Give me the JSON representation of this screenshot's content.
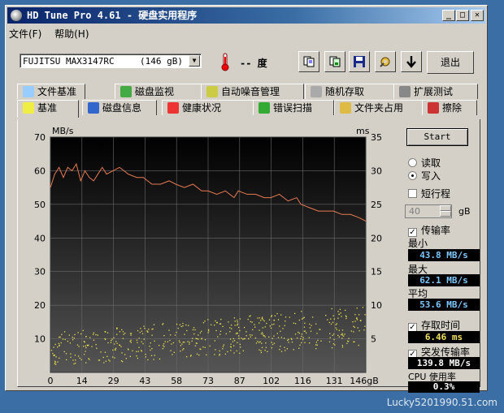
{
  "window": {
    "title": "HD Tune Pro 4.61 - 硬盘实用程序"
  },
  "menu": {
    "file": "文件(F)",
    "help": "帮助(H)"
  },
  "toolbar": {
    "drive_name": "FUJITSU MAX3147RC",
    "drive_size": "(146 gB)",
    "temperature": "-- 度",
    "exit_label": "退出"
  },
  "tabs_top": [
    "文件基准",
    "磁盘监视",
    "自动噪音管理",
    "随机存取",
    "扩展测试"
  ],
  "tabs_bottom": [
    "基准",
    "磁盘信息",
    "健康状况",
    "错误扫描",
    "文件夹占用",
    "擦除"
  ],
  "active_tab": "基准",
  "controls": {
    "start_label": "Start",
    "read_label": "读取",
    "write_label": "写入",
    "mode_selected": "写入",
    "short_stroke_label": "短行程",
    "short_stroke_checked": false,
    "short_stroke_value": "40",
    "short_stroke_unit": "gB",
    "transfer_rate_label": "传输率",
    "transfer_rate_checked": true,
    "min_label": "最小",
    "min_value": "43.8 MB/s",
    "max_label": "最大",
    "max_value": "62.1 MB/s",
    "avg_label": "平均",
    "avg_value": "53.6 MB/s",
    "access_time_label": "存取时间",
    "access_time_checked": true,
    "access_time_value": "6.46 ms",
    "burst_label": "突发传输率",
    "burst_checked": true,
    "burst_value": "139.8 MB/s",
    "cpu_label": "CPU 使用率",
    "cpu_value": "0.3%"
  },
  "chart_data": {
    "type": "line",
    "ylabel_left": "MB/s",
    "ylabel_right": "ms",
    "yticks_left": [
      70,
      60,
      50,
      40,
      30,
      20,
      10
    ],
    "yticks_right": [
      35,
      30,
      25,
      20,
      15,
      10,
      5
    ],
    "ylim_left": [
      0,
      70
    ],
    "ylim_right": [
      0,
      35
    ],
    "xticks": [
      "0",
      "14",
      "29",
      "43",
      "58",
      "73",
      "87",
      "102",
      "116",
      "131",
      "146gB"
    ],
    "xlim": [
      0,
      146
    ],
    "grid": true,
    "series": [
      {
        "color": "#e87a50",
        "axis": "left",
        "x": [
          0,
          2,
          4,
          6,
          8,
          10,
          12,
          14,
          16,
          18,
          20,
          22,
          24,
          26,
          29,
          32,
          36,
          40,
          43,
          47,
          51,
          55,
          58,
          62,
          66,
          70,
          73,
          77,
          81,
          85,
          87,
          91,
          95,
          99,
          102,
          106,
          110,
          114,
          116,
          120,
          124,
          128,
          131,
          135,
          139,
          143,
          146
        ],
        "y": [
          55,
          59,
          61,
          58,
          61,
          60,
          62,
          57,
          60,
          58,
          57,
          59,
          61,
          59,
          60,
          61,
          59,
          58,
          58,
          56,
          56,
          57,
          56,
          55,
          56,
          54,
          54,
          53,
          54,
          52,
          54,
          53,
          53,
          52,
          52,
          53,
          51,
          52,
          50,
          49,
          48,
          48,
          48,
          47,
          47,
          46,
          45
        ]
      },
      {
        "color": "#e8e04a",
        "axis": "right",
        "kind": "scatter",
        "x_range": [
          0,
          146
        ],
        "y_band_start": [
          1,
          6
        ],
        "y_band_end": [
          4,
          10
        ]
      }
    ]
  },
  "watermark": "Lucky5201990.51.com"
}
